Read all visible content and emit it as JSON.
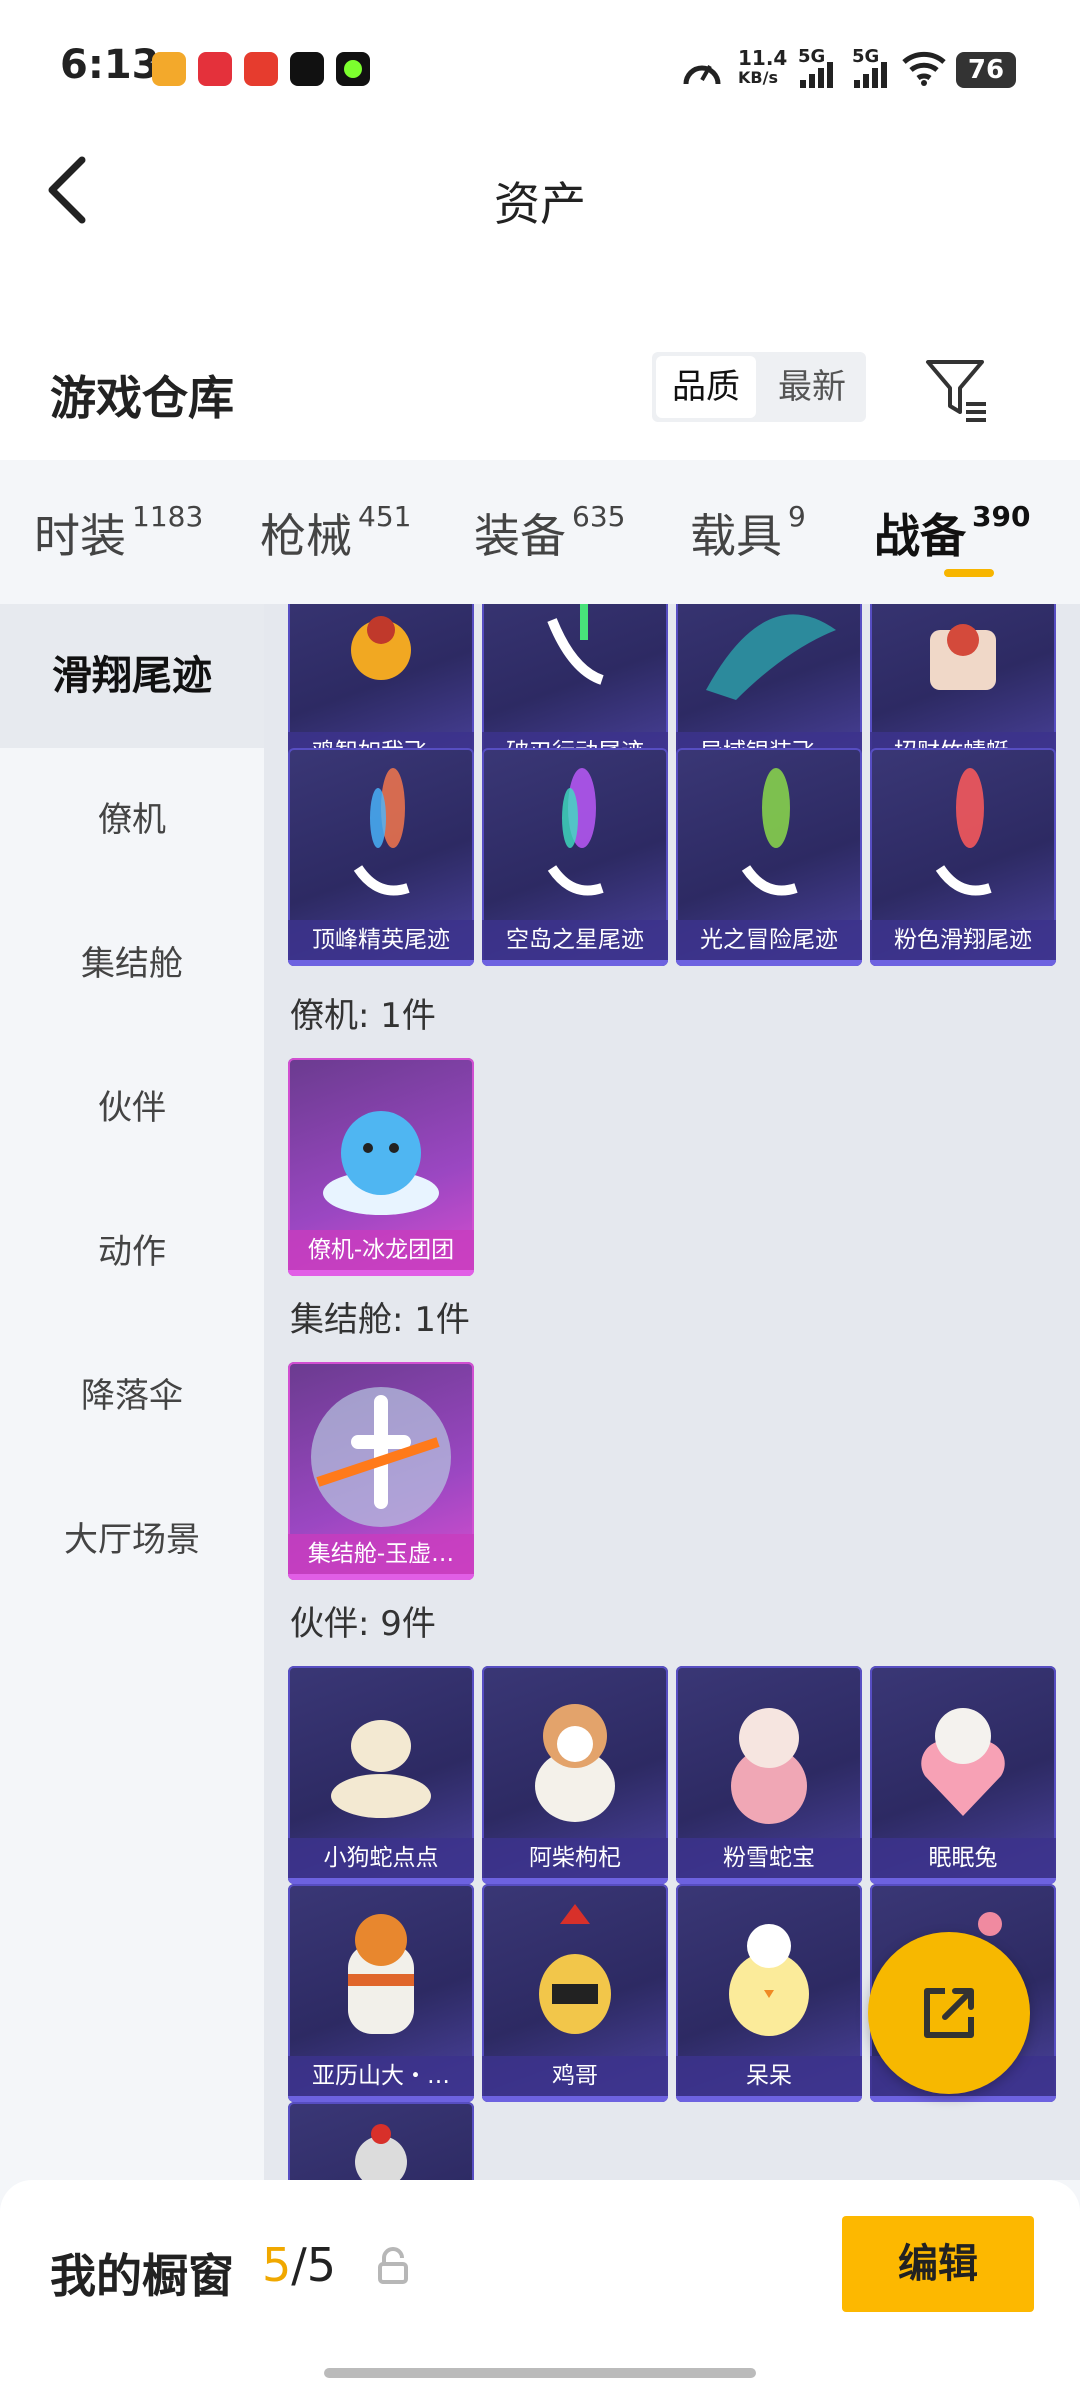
{
  "status_bar": {
    "time": "6:13",
    "net_speed": "11.4",
    "net_unit": "KB/s",
    "signal1": "5G",
    "signal2": "5G",
    "battery": "76"
  },
  "header": {
    "title": "资产",
    "back_icon": "chevron-left-icon"
  },
  "warehouse": {
    "title": "游戏仓库",
    "sort_options": [
      "品质",
      "最新"
    ],
    "active_sort": "品质",
    "filter_icon": "filter-icon"
  },
  "tabs": [
    {
      "label": "时装",
      "count": "1183"
    },
    {
      "label": "枪械",
      "count": "451"
    },
    {
      "label": "装备",
      "count": "635"
    },
    {
      "label": "载具",
      "count": "9"
    },
    {
      "label": "战备",
      "count": "390",
      "active": true
    }
  ],
  "sidebar": {
    "items": [
      "滑翔尾迹",
      "僚机",
      "集结舱",
      "伙伴",
      "动作",
      "降落伞",
      "大厅场景"
    ],
    "active": "滑翔尾迹"
  },
  "content": {
    "trails_row1": [
      "鸡智如我飞…",
      "破刃行动尾迹",
      "异域银装飞…",
      "招财竹蜻蜓…"
    ],
    "trails_row2": [
      "顶峰精英尾迹",
      "空岛之星尾迹",
      "光之冒险尾迹",
      "粉色滑翔尾迹"
    ],
    "wingman_title": "僚机: 1件",
    "wingman_items": [
      "僚机-冰龙团团"
    ],
    "pod_title": "集结舱: 1件",
    "pod_items": [
      "集结舱-玉虚…"
    ],
    "partner_title": "伙伴: 9件",
    "partner_row1": [
      "小狗蛇点点",
      "阿柴枸杞",
      "粉雪蛇宝",
      "眠眠兔"
    ],
    "partner_row2": [
      "亚历山大・…",
      "鸡哥",
      "呆呆",
      "…"
    ]
  },
  "fab": {
    "icon": "share-external-icon"
  },
  "bottom_bar": {
    "title": "我的橱窗",
    "count_current": "5",
    "count_sep": "/5",
    "lock_icon": "lock-icon",
    "edit_label": "编辑"
  }
}
